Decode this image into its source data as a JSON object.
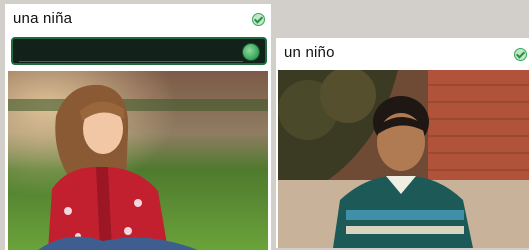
{
  "cards": [
    {
      "label": "una niña",
      "check_icon": "check-circle-icon",
      "image": "girl-photo"
    },
    {
      "label": "un niño",
      "check_icon": "check-circle-icon",
      "image": "boy-photo"
    }
  ],
  "answer": {
    "value": "",
    "placeholder": ""
  },
  "colors": {
    "answer_bg": "#13211b",
    "accent_green": "#34a453"
  }
}
